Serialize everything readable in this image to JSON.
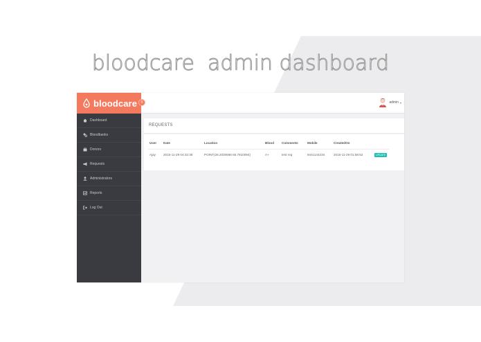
{
  "headline": "bloodcare  admin dashboard",
  "colors": {
    "brand": "#f47a5f",
    "sidebar": "#3a3b40",
    "badge": "#1dbfaf",
    "background_shape": "#ececee"
  },
  "brand": {
    "name": "bloodcare",
    "logo_icon": "drop-logo-icon",
    "collapse_icon": "collapse-icon"
  },
  "sidebar": {
    "items": [
      {
        "label": "Dashboard",
        "icon": "dashboard-icon"
      },
      {
        "label": "Bloodbanks",
        "icon": "bloodbanks-icon"
      },
      {
        "label": "Donors",
        "icon": "donors-icon"
      },
      {
        "label": "Requests",
        "icon": "megaphone-icon"
      },
      {
        "label": "Administrators",
        "icon": "user-icon"
      },
      {
        "label": "Reports",
        "icon": "reports-icon"
      },
      {
        "label": "Log Out",
        "icon": "logout-icon"
      }
    ]
  },
  "header": {
    "user_name": "admin",
    "avatar_icon": "avatar-icon",
    "caret": "▾"
  },
  "panel": {
    "title": "REQUESTS",
    "columns": [
      "User",
      "Date",
      "Location",
      "Blood",
      "Comments",
      "Mobile",
      "CreatedOn",
      ""
    ],
    "rows": [
      {
        "user": "Ajay",
        "date": "2015-11-29 04:32:35",
        "location": "POINT(26.2030666 65.7910094)",
        "blood": "A+",
        "comments": "test req",
        "mobile": "9441144234",
        "created_on": "2015-11-29 01:58:52",
        "action": "UPDATE"
      }
    ]
  }
}
